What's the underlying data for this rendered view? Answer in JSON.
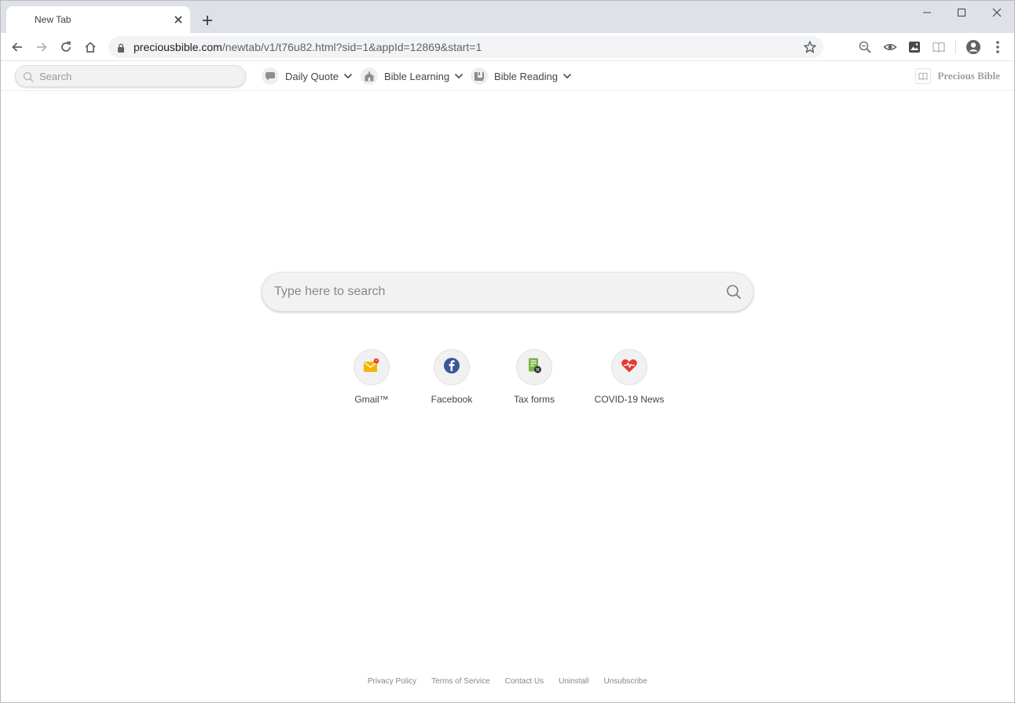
{
  "browser": {
    "tab_title": "New Tab",
    "url_host": "preciousbible.com",
    "url_path": "/newtab/v1/t76u82.html?sid=1&appId=12869&start=1"
  },
  "extension_bar": {
    "search_placeholder": "Search",
    "menus": [
      {
        "label": "Daily Quote",
        "icon": "quote-icon"
      },
      {
        "label": "Bible Learning",
        "icon": "church-icon"
      },
      {
        "label": "Bible Reading",
        "icon": "book-icon"
      }
    ],
    "brand": "Precious Bible"
  },
  "main": {
    "search_placeholder": "Type here to search",
    "tiles": [
      {
        "label": "Gmail™",
        "icon": "gmail-icon"
      },
      {
        "label": "Facebook",
        "icon": "facebook-icon"
      },
      {
        "label": "Tax forms",
        "icon": "tax-forms-icon"
      },
      {
        "label": "COVID-19 News",
        "icon": "heart-pulse-icon"
      }
    ]
  },
  "footer": {
    "links": [
      "Privacy Policy",
      "Terms of Service",
      "Contact Us",
      "Uninstall",
      "Unsubscribe"
    ]
  },
  "colors": {
    "tabstrip": "#dee1e6",
    "omnibox": "#f1f3f4",
    "facebook": "#3b5998",
    "gmail": "#f5b400",
    "tax": "#7cb342",
    "covid": "#e53935"
  }
}
